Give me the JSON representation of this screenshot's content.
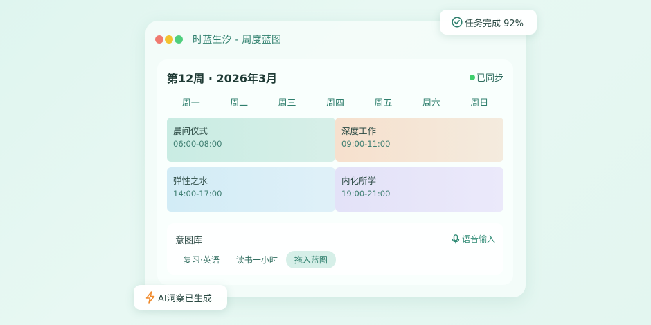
{
  "window": {
    "title": "时蓝生汐 - 周度蓝图"
  },
  "header": {
    "week_title": "第12周 · 2026年3月",
    "sync_status": "已同步"
  },
  "days": [
    "周一",
    "周二",
    "周三",
    "周四",
    "周五",
    "周六",
    "周日"
  ],
  "blocks": [
    {
      "title": "晨间仪式",
      "time": "06:00-08:00"
    },
    {
      "title": "深度工作",
      "time": "09:00-11:00"
    },
    {
      "title": "弹性之水",
      "time": "14:00-17:00"
    },
    {
      "title": "内化所学",
      "time": "19:00-21:00"
    }
  ],
  "intent": {
    "title": "意图库",
    "voice_label": "语音输入",
    "chips": [
      "复习·英语",
      "读书一小时",
      "拖入蓝图"
    ]
  },
  "badges": {
    "task": "任务完成 92%",
    "ai": "AI洞察已生成"
  },
  "colors": {
    "accent": "#2f7f6d",
    "sync": "#3fcf6d",
    "ai_icon": "#f08a2c"
  }
}
